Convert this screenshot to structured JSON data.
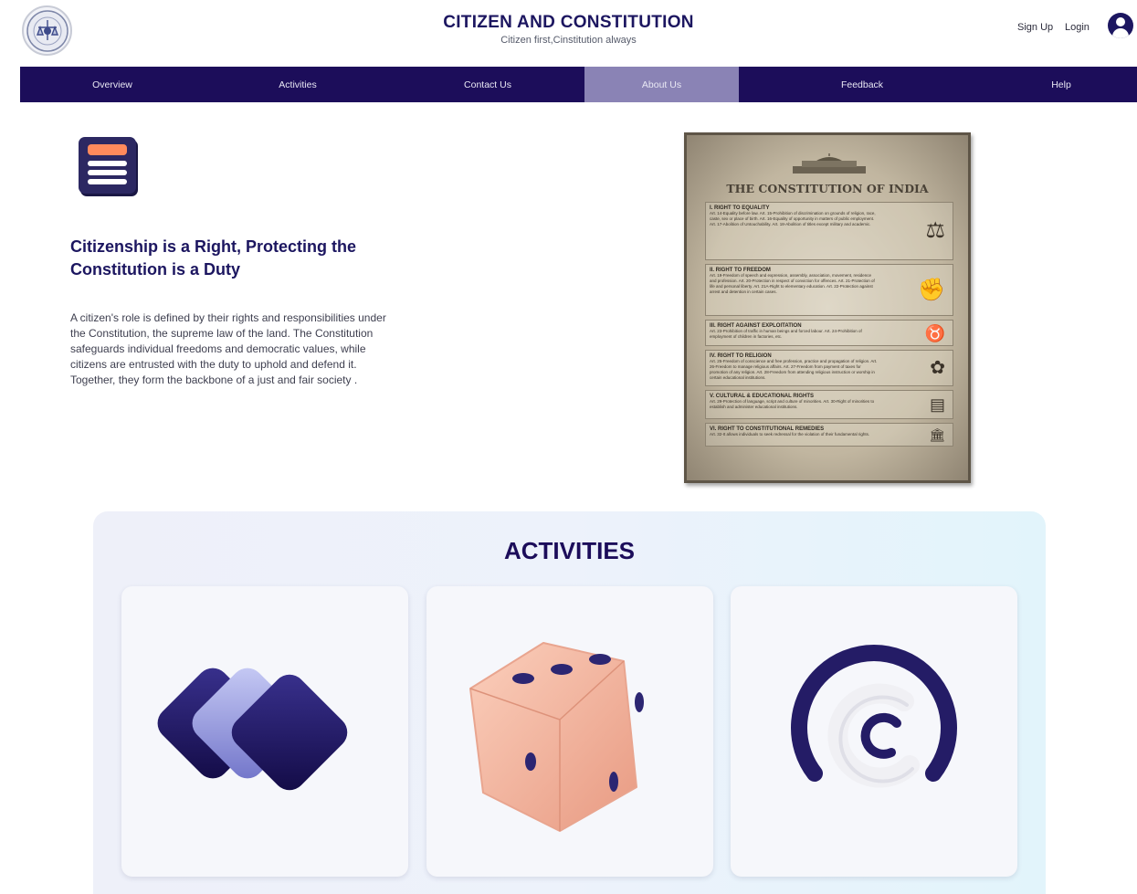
{
  "header": {
    "title": "CITIZEN AND CONSTITUTION",
    "subtitle": "Citizen first,Cinstitution always",
    "signup_label": "Sign Up",
    "login_label": "Login",
    "logo_icon": "emblem-icon",
    "user_icon": "user-avatar-icon"
  },
  "nav": {
    "items": [
      {
        "label": "Overview"
      },
      {
        "label": "Activities"
      },
      {
        "label": "Contact Us"
      },
      {
        "label": "About Us"
      },
      {
        "label": "Feedback"
      },
      {
        "label": "Help"
      }
    ],
    "active": "About Us"
  },
  "hero": {
    "icon": "document-list-icon",
    "title": "Citizenship is a Right, Protecting the Constitution is a Duty",
    "text": "A citizen's role is defined by their rights and responsibilities under the Constitution, the supreme law of the land. The Constitution safeguards individual freedoms and democratic values, while citizens are entrusted with the duty to uphold and defend it. Together, they form the backbone of a just and fair society ."
  },
  "poster": {
    "title": "THE CONSTITUTION OF INDIA",
    "sections": [
      {
        "title": "I. RIGHT TO EQUALITY",
        "text": "Art. 14-Equality before law. Art. 15-Prohibition of discrimination on grounds of religion, race, caste, sex or place of birth. Art. 16-Equality of opportunity in matters of public employment. Art. 17-Abolition of Untouchability. Art. 18-Abolition of titles except military and academic.",
        "icon": "scales-icon"
      },
      {
        "title": "II. RIGHT TO FREEDOM",
        "text": "Art. 19-Freedom of speech and expression, assembly, association, movement, residence and profession. Art. 20-Protection in respect of conviction for offences. Art. 21-Protection of life and personal liberty. Art. 21A-Right to elementary education. Art. 22-Protection against arrest and detention in certain cases.",
        "icon": "raised-fist-icon"
      },
      {
        "title": "III. RIGHT AGAINST EXPLOITATION",
        "text": "Art. 23-Prohibition of traffic in human beings and forced labour. Art. 24-Prohibition of employment of children in factories, etc.",
        "icon": "bull-icon"
      },
      {
        "title": "IV. RIGHT TO RELIGION",
        "text": "Art. 25-Freedom of conscience and free profession, practice and propagation of religion. Art. 26-Freedom to manage religious affairs. Art. 27-Freedom from payment of taxes for promotion of any religion. Art. 28-Freedom from attending religious instruction or worship in certain educational institutions.",
        "icon": "religion-symbols-icon"
      },
      {
        "title": "V. CULTURAL & EDUCATIONAL RIGHTS",
        "text": "Art. 29-Protection of language, script and culture of minorities. Art. 30-Right of minorities to establish and administer educational institutions.",
        "icon": "book-icon"
      },
      {
        "title": "VI. RIGHT TO CONSTITUTIONAL REMEDIES",
        "text": "Art. 32-It allows individuals to seek redressal for the violation of their fundamental rights.",
        "icon": "parliament-icon"
      }
    ]
  },
  "activities": {
    "title": "ACTIVITIES",
    "cards": [
      {
        "icon": "stacked-cards-icon"
      },
      {
        "icon": "dice-icon"
      },
      {
        "icon": "spinner-ring-icon"
      }
    ]
  },
  "colors": {
    "primary": "#1c0d5a",
    "nav_active": "#8a83b5",
    "accent": "#ff8a5c",
    "dice": "#f7b79f"
  }
}
